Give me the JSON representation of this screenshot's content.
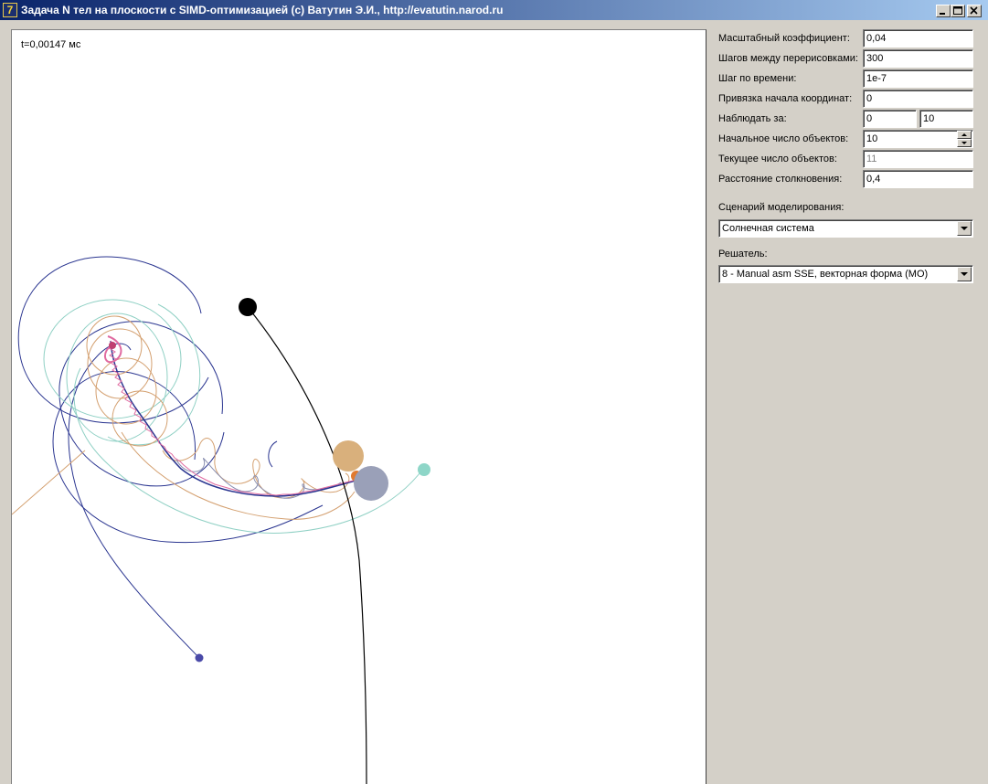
{
  "window": {
    "title": "Задача N тел на плоскости с SIMD-оптимизацией (c) Ватутин Э.И., http://evatutin.narod.ru"
  },
  "canvas": {
    "time_label": "t=0,00147 мс"
  },
  "settings": {
    "scale_label": "Масштабный коэффициент:",
    "scale_value": "0,04",
    "steps_label": "Шагов между перерисовками:",
    "steps_value": "300",
    "timestep_label": "Шаг по времени:",
    "timestep_value": "1e-7",
    "origin_label": "Привязка начала координат:",
    "origin_value": "0",
    "watch_label": "Наблюдать за:",
    "watch_from": "0",
    "watch_to": "10",
    "initial_count_label": "Начальное число объектов:",
    "initial_count_value": "10",
    "current_count_label": "Текущее число объектов:",
    "current_count_value": "11",
    "collision_label": "Расстояние столкновения:",
    "collision_value": "0,4"
  },
  "scenario": {
    "label": "Сценарий моделирования:",
    "value": "Солнечная система"
  },
  "solver": {
    "label": "Решатель:",
    "value": "8 - Manual asm SSE, векторная форма (MO)"
  },
  "colors": {
    "titlebar_start": "#0a246a",
    "titlebar_end": "#a6caf0",
    "panel_bg": "#d4d0c8",
    "orbit_navy": "#2a3590",
    "orbit_teal": "#8fd0c4",
    "orbit_orange": "#d4a070",
    "body_black": "#000000",
    "body_tan": "#d9b07c",
    "body_slate": "#9aa0b8",
    "body_cyan": "#8ed6c8",
    "body_orange": "#e07a30",
    "body_navy": "#4a4aa8",
    "wiggle_pink": "#e06aa0"
  },
  "icons": {
    "app": "app-icon",
    "minimize": "minimize-icon",
    "maximize": "maximize-icon",
    "close": "close-icon",
    "spin_up": "spin-up-icon",
    "spin_down": "spin-down-icon",
    "dropdown": "chevron-down-icon"
  }
}
